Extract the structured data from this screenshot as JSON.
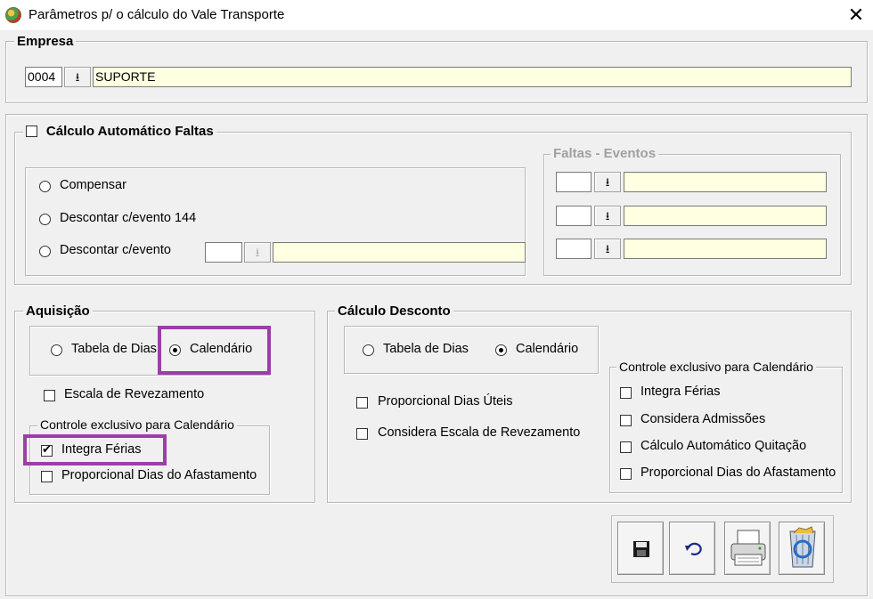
{
  "window": {
    "title": "Parâmetros p/ o cálculo do Vale Transporte",
    "close_glyph": "✕"
  },
  "empresa": {
    "legend": "Empresa",
    "code": "0004",
    "name": "SUPORTE",
    "lookup_glyph": "⭳"
  },
  "faltas": {
    "auto_label": "Cálculo Automático Faltas",
    "auto_checked": false,
    "options": [
      "Compensar",
      "Descontar c/evento 144",
      "Descontar c/evento"
    ],
    "eventos_legend": "Faltas - Eventos"
  },
  "aquisicao": {
    "legend": "Aquisição",
    "radio_tabela": "Tabela de Dias",
    "radio_calendario": "Calendário",
    "selected": "Calendário",
    "escala": "Escala de Revezamento",
    "controle_legend": "Controle exclusivo para Calendário",
    "integra_ferias": "Integra Férias",
    "integra_checked": true,
    "proporcional": "Proporcional Dias do Afastamento"
  },
  "calculo_desconto": {
    "legend": "Cálculo Desconto",
    "radio_tabela": "Tabela de Dias",
    "radio_calendario": "Calendário",
    "selected": "Calendário",
    "proporcional_uteis": "Proporcional Dias Úteis",
    "considera_escala": "Considera Escala de Revezamento",
    "controle_legend": "Controle exclusivo para Calendário",
    "integra_ferias": "Integra Férias",
    "considera_admissoes": "Considera Admissões",
    "calculo_quitacao": "Cálculo Automático Quitação",
    "proporcional_afast": "Proporcional Dias do Afastamento"
  },
  "toolbar": {
    "icons": [
      "save-icon",
      "undo-icon",
      "print-icon",
      "recycle-bin-icon"
    ]
  },
  "colors": {
    "highlight": "#9b3fa8",
    "input_yellow": "#ffffe1"
  }
}
